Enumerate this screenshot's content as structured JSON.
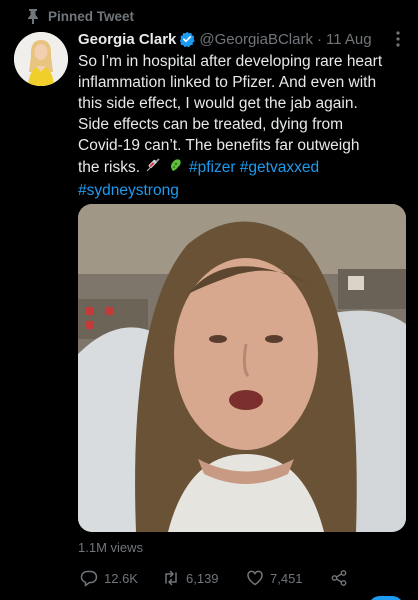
{
  "pinned": {
    "label": "Pinned Tweet",
    "icon": "pin-icon"
  },
  "author": {
    "name": "Georgia Clark",
    "handle": "@GeorgiaBClark",
    "separator": "·",
    "date": "11 Aug",
    "verified": true
  },
  "tweet": {
    "line1": "So I’m in hospital after developing rare heart",
    "line2": "inflammation linked to Pfizer. And even with",
    "line3": "this side effect, I would get the jab again.",
    "line4": "Side effects can be treated, dying from",
    "line5": "Covid-19 can’t. The benefits far outweigh",
    "line6": "the risks.",
    "emoji_syringe": "💉",
    "emoji_microbe": "🦠",
    "hashtag_pfizer": "#pfizer",
    "hashtag_getvaxxed": "#getvaxxed",
    "hashtag_sydneystrong": "#sydneystrong"
  },
  "stats": {
    "views": "1.1M views",
    "replies": "12.6K",
    "retweets": "6,139",
    "likes": "7,451"
  },
  "colors": {
    "background": "#000000",
    "text": "#e7e9ea",
    "muted": "#71767b",
    "link": "#1d9bf0"
  }
}
